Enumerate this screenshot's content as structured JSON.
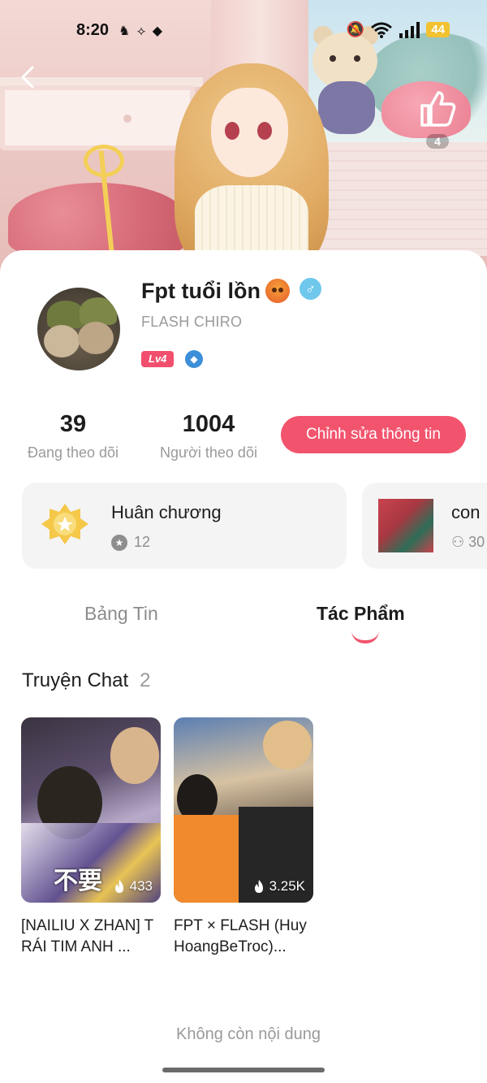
{
  "status_bar": {
    "time": "8:20",
    "battery": "44"
  },
  "profile": {
    "name": "Fpt tuổi lồn",
    "subname": "FLASH CHIRO",
    "level": "Lv4",
    "likes": "4"
  },
  "stats": {
    "following_count": "39",
    "following_label": "Đang theo dõi",
    "followers_count": "1004",
    "followers_label": "Người theo dõi",
    "edit_button": "Chỉnh sửa thông tin"
  },
  "cards": {
    "medal_title": "Huân chương",
    "medal_count": "12",
    "group_title": "con",
    "group_count": "30"
  },
  "tabs": [
    {
      "label": "Bảng Tin",
      "active": false
    },
    {
      "label": "Tác Phẩm",
      "active": true
    }
  ],
  "section": {
    "title": "Truyện Chat",
    "count": "2"
  },
  "stories": [
    {
      "title": "[NAILIU X ZHAN] TRÁI TIM ANH ...",
      "views": "433",
      "cover_text": "不要"
    },
    {
      "title": "FPT × FLASH (HuyHoangBeTroc)...",
      "views": "3.25K"
    }
  ],
  "footer": {
    "end_note": "Không còn nội dung"
  },
  "colors": {
    "accent": "#f2546d",
    "level_badge": "#f14f6d",
    "male_badge": "#6fc8ec"
  },
  "icons": [
    "back-arrow-icon",
    "thumbs-up-icon",
    "male-icon",
    "diamond-icon",
    "medal-icon",
    "star-icon",
    "people-icon",
    "flame-icon"
  ]
}
